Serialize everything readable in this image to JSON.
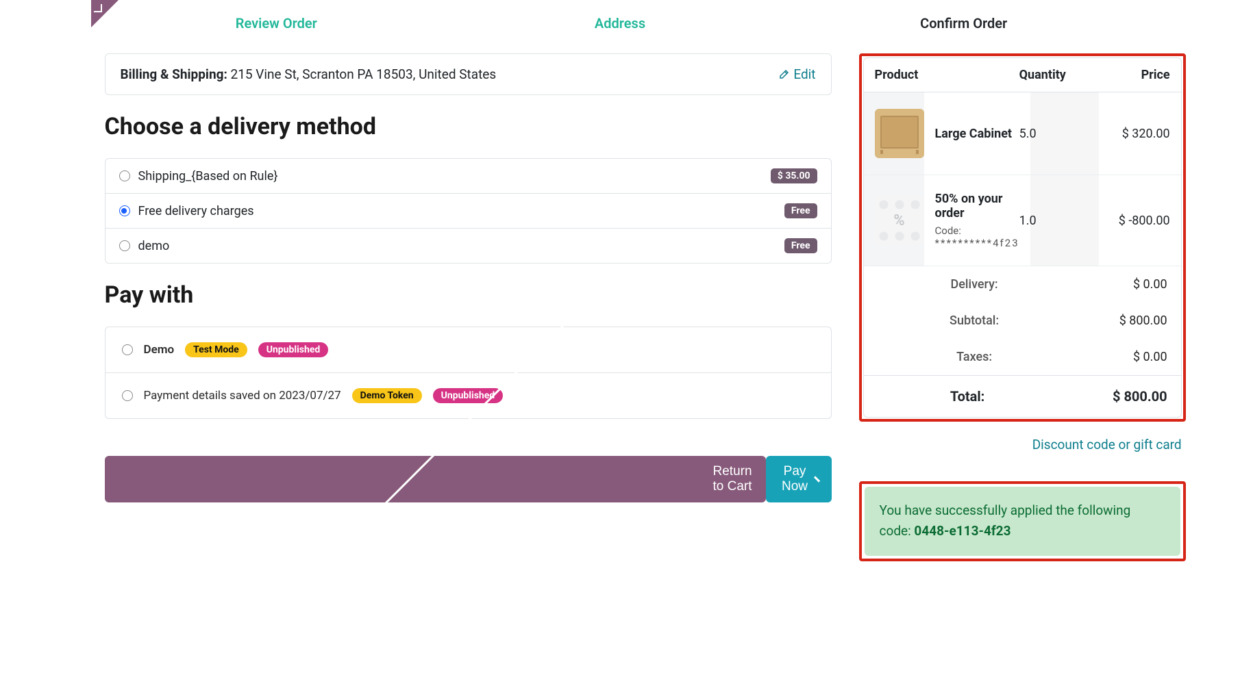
{
  "steps": {
    "review": "Review Order",
    "address": "Address",
    "confirm": "Confirm Order"
  },
  "shipping": {
    "label": "Billing & Shipping:",
    "address": "215 Vine St, Scranton PA 18503, United States",
    "edit": "Edit"
  },
  "delivery": {
    "heading": "Choose a delivery method",
    "options": [
      {
        "label": "Shipping_{Based on Rule}",
        "price": "$ 35.00",
        "free": false,
        "checked": false
      },
      {
        "label": "Free delivery charges",
        "price": "Free",
        "free": true,
        "checked": true
      },
      {
        "label": "demo",
        "price": "Free",
        "free": true,
        "checked": false
      }
    ]
  },
  "pay": {
    "heading": "Pay with",
    "options": [
      {
        "label": "Demo",
        "bold": true,
        "badges": [
          {
            "text": "Test Mode",
            "style": "yellow"
          },
          {
            "text": "Unpublished",
            "style": "pink"
          }
        ]
      },
      {
        "label": "Payment details saved on 2023/07/27",
        "bold": false,
        "badges": [
          {
            "text": "Demo Token",
            "style": "yellow"
          },
          {
            "text": "Unpublished",
            "style": "pink"
          }
        ]
      }
    ]
  },
  "actions": {
    "return": "Return to Cart",
    "paynow": "Pay Now"
  },
  "summary": {
    "head_product": "Product",
    "head_qty": "Quantity",
    "head_price": "Price",
    "items": [
      {
        "name": "Large Cabinet",
        "qty": "5.0",
        "price": "$ 320.00",
        "thumb": "cabinet"
      },
      {
        "name": "50% on your order",
        "code_label": "Code:",
        "code": "**********4f23",
        "qty": "1.0",
        "price": "$ -800.00",
        "thumb": "promo"
      }
    ],
    "lines": [
      {
        "label": "Delivery:",
        "value": "$ 0.00"
      },
      {
        "label": "Subtotal:",
        "value": "$ 800.00"
      },
      {
        "label": "Taxes:",
        "value": "$ 0.00"
      }
    ],
    "total_label": "Total:",
    "total_value": "$ 800.00"
  },
  "promo_link": "Discount code or gift card",
  "alert": {
    "text": "You have successfully applied the following code: ",
    "code": "0448-e113-4f23"
  }
}
